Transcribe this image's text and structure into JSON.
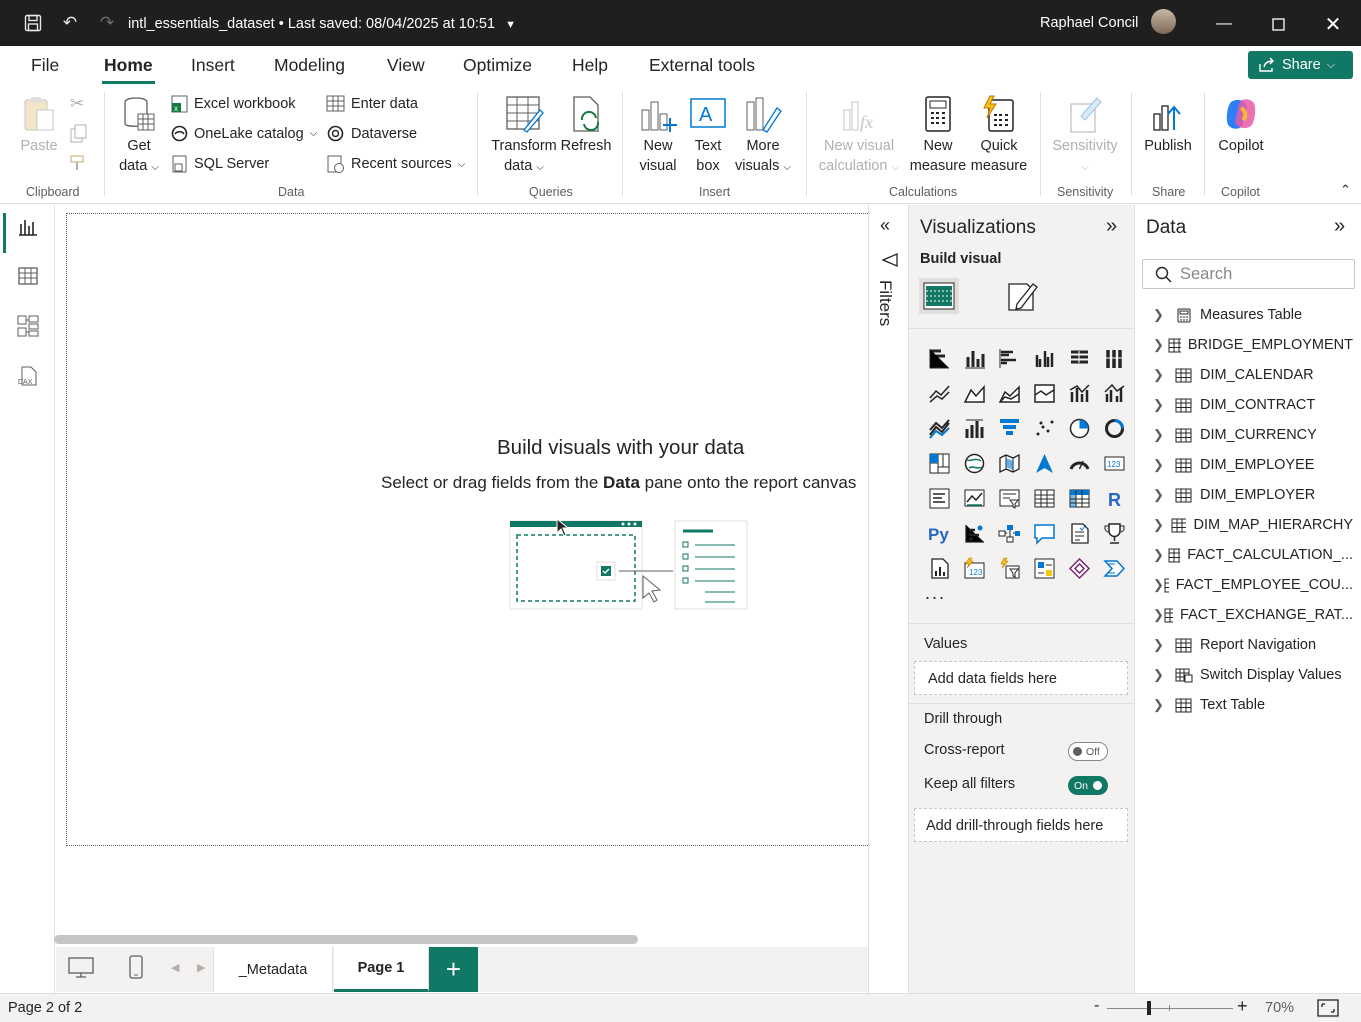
{
  "titlebar": {
    "file_name": "intl_essentials_dataset",
    "saved_text": "Last saved: 08/04/2025 at 10:51",
    "user": "Raphael Concil"
  },
  "menu": {
    "tabs": [
      "File",
      "Home",
      "Insert",
      "Modeling",
      "View",
      "Optimize",
      "Help",
      "External tools"
    ],
    "active": "Home",
    "share_label": "Share"
  },
  "ribbon": {
    "clipboard": {
      "paste": "Paste",
      "group": "Clipboard"
    },
    "data": {
      "get_data_1": "Get",
      "get_data_2": "data",
      "excel": "Excel workbook",
      "onelake": "OneLake catalog",
      "sql": "SQL Server",
      "enter": "Enter data",
      "dataverse": "Dataverse",
      "recent": "Recent sources",
      "group": "Data"
    },
    "queries": {
      "transform_1": "Transform",
      "transform_2": "data",
      "refresh": "Refresh",
      "group": "Queries"
    },
    "insert": {
      "new_visual_1": "New",
      "new_visual_2": "visual",
      "text_box_1": "Text",
      "text_box_2": "box",
      "more_visuals_1": "More",
      "more_visuals_2": "visuals",
      "group": "Insert"
    },
    "calculations": {
      "new_visual_calc_1": "New visual",
      "new_visual_calc_2": "calculation",
      "new_measure_1": "New",
      "new_measure_2": "measure",
      "quick_measure_1": "Quick",
      "quick_measure_2": "measure",
      "group": "Calculations"
    },
    "sensitivity": {
      "label": "Sensitivity",
      "group": "Sensitivity"
    },
    "share": {
      "publish": "Publish",
      "group": "Share"
    },
    "copilot": {
      "label": "Copilot",
      "group": "Copilot"
    }
  },
  "canvas": {
    "heading": "Build visuals with your data",
    "sub_pre": "Select or drag fields from the ",
    "sub_bold": "Data",
    "sub_post": " pane onto the report canvas"
  },
  "pages": {
    "tabs": [
      "_Metadata",
      "Page 1"
    ],
    "active": "Page 1",
    "add": "+"
  },
  "status": {
    "page": "Page 2 of 2",
    "zoom": "70%"
  },
  "filters": {
    "label": "Filters"
  },
  "visualizations": {
    "title": "Visualizations",
    "build_visual": "Build visual",
    "values_label": "Values",
    "values_placeholder": "Add data fields here",
    "drill_through": "Drill through",
    "cross_report": "Cross-report",
    "cross_report_state": "Off",
    "keep_filters": "Keep all filters",
    "keep_filters_state": "On",
    "drill_placeholder": "Add drill-through fields here",
    "more": "..."
  },
  "data_pane": {
    "title": "Data",
    "search_placeholder": "Search",
    "tables": [
      {
        "name": "Measures Table",
        "icon": "calculator-icon"
      },
      {
        "name": "BRIDGE_EMPLOYMENT",
        "icon": "table-icon"
      },
      {
        "name": "DIM_CALENDAR",
        "icon": "table-icon"
      },
      {
        "name": "DIM_CONTRACT",
        "icon": "table-icon"
      },
      {
        "name": "DIM_CURRENCY",
        "icon": "table-icon"
      },
      {
        "name": "DIM_EMPLOYEE",
        "icon": "table-icon"
      },
      {
        "name": "DIM_EMPLOYER",
        "icon": "table-icon"
      },
      {
        "name": "DIM_MAP_HIERARCHY",
        "icon": "table-icon"
      },
      {
        "name": "FACT_CALCULATION_...",
        "icon": "table-icon"
      },
      {
        "name": "FACT_EMPLOYEE_COU...",
        "icon": "table-icon"
      },
      {
        "name": "FACT_EXCHANGE_RAT...",
        "icon": "table-icon"
      },
      {
        "name": "Report Navigation",
        "icon": "table-icon"
      },
      {
        "name": "Switch Display Values",
        "icon": "calc-table-icon"
      },
      {
        "name": "Text Table",
        "icon": "table-icon"
      }
    ]
  },
  "colors": {
    "accent": "#117865",
    "titlebar": "#1f1f1f"
  }
}
